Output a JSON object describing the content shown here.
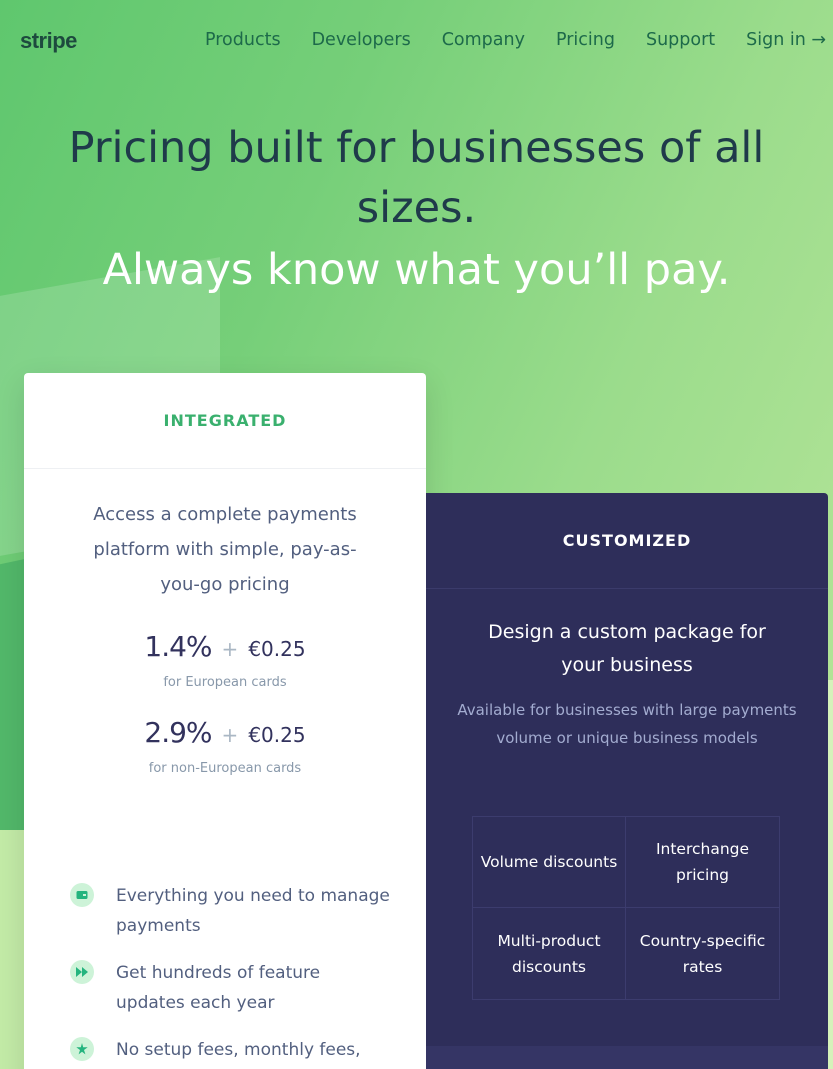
{
  "nav": {
    "logo": "stripe",
    "links": [
      "Products",
      "Developers",
      "Company",
      "Pricing",
      "Support",
      "Sign in →"
    ]
  },
  "hero": {
    "title": "Pricing built for businesses of all sizes.",
    "subtitle": "Always know what you’ll pay."
  },
  "integrated": {
    "label": "INTEGRATED",
    "description": "Access a complete payments platform with simple, pay-as-you-go pricing",
    "prices": [
      {
        "percent": "1.4%",
        "plus": "+",
        "fee": "€0.25",
        "note": "for European cards"
      },
      {
        "percent": "2.9%",
        "plus": "+",
        "fee": "€0.25",
        "note": "for non-European cards"
      }
    ],
    "features": [
      {
        "icon": "wallet-icon",
        "text": "Everything you need to manage payments"
      },
      {
        "icon": "fast-forward-icon",
        "text": "Get hundreds of feature updates each year"
      },
      {
        "icon": "star-icon",
        "text": "No setup fees, monthly fees,"
      }
    ]
  },
  "customized": {
    "label": "CUSTOMIZED",
    "title": "Design a custom package for your business",
    "subtitle": "Available for businesses with large payments volume or unique business models",
    "options": [
      "Volume discounts",
      "Interchange pricing",
      "Multi-product discounts",
      "Country-specific rates"
    ]
  },
  "colors": {
    "accent_green": "#3ab06e",
    "card_dark": "#2e2e5a",
    "text_dark": "#32325d"
  }
}
